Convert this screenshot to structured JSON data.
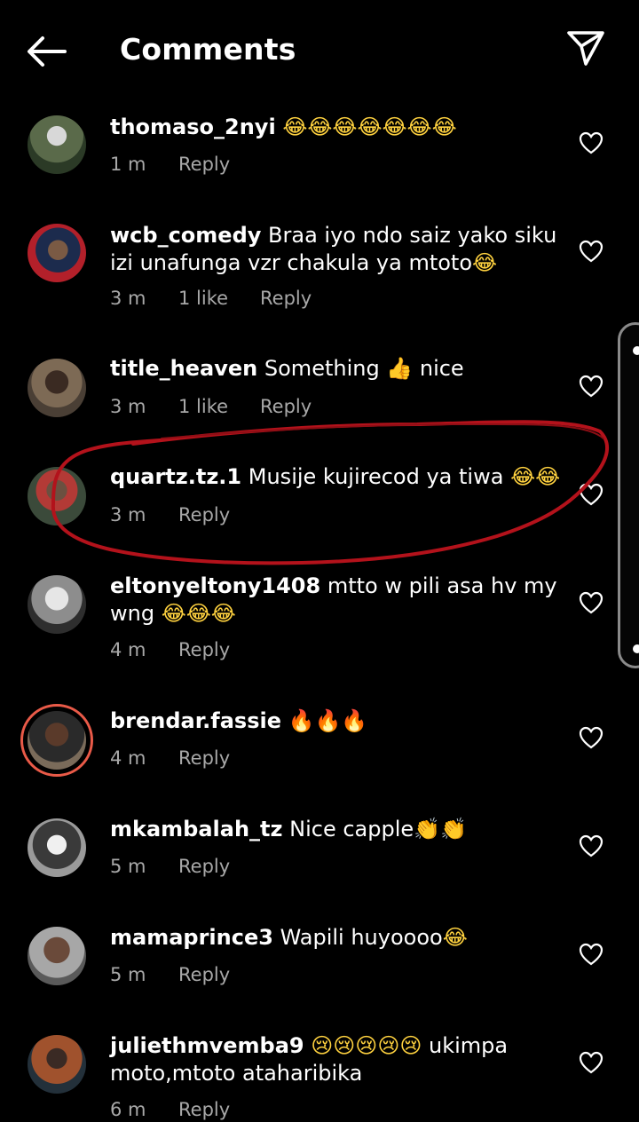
{
  "header": {
    "title": "Comments",
    "back_icon": "arrow-left-icon",
    "send_icon": "paper-plane-icon"
  },
  "colors": {
    "background": "#000000",
    "text": "#ffffff",
    "meta_text": "#a8a8a8",
    "annotation": "#b3121b",
    "story_ring": "#e95a48"
  },
  "comments": [
    {
      "username": "thomaso_2nyi",
      "text": "",
      "emoji": "😂😂😂😂😂😂😂",
      "time": "1 m",
      "likes": "",
      "reply": "Reply"
    },
    {
      "username": "wcb_comedy",
      "text": "Braa iyo ndo saiz yako siku izi unafunga vzr chakula ya mtoto",
      "emoji": "😂",
      "time": "3 m",
      "likes": "1 like",
      "reply": "Reply"
    },
    {
      "username": "title_heaven",
      "text": "Something",
      "emoji": "👍",
      "text_after": "nice",
      "time": "3 m",
      "likes": "1 like",
      "reply": "Reply"
    },
    {
      "username": "quartz.tz.1",
      "text": "Musije kujirecod ya tiwa",
      "emoji": "😂😂",
      "time": "3 m",
      "likes": "",
      "reply": "Reply"
    },
    {
      "username": "eltonyeltony1408",
      "text": "mtto w pili asa hv my wng",
      "emoji": "😂😂😂",
      "time": "4 m",
      "likes": "",
      "reply": "Reply"
    },
    {
      "username": "brendar.fassie",
      "text": "",
      "emoji": "🔥🔥🔥",
      "time": "4 m",
      "likes": "",
      "reply": "Reply"
    },
    {
      "username": "mkambalah_tz",
      "text": "Nice capple",
      "emoji": "👏👏",
      "time": "5 m",
      "likes": "",
      "reply": "Reply"
    },
    {
      "username": "mamaprince3",
      "text": "Wapili huyoooo",
      "emoji": "😂",
      "time": "5 m",
      "likes": "",
      "reply": "Reply"
    },
    {
      "username": "juliethmvemba9",
      "text": "",
      "emoji": "😢😢😢😢😢",
      "text_after": "ukimpa moto,mtoto ataharibika",
      "time": "6 m",
      "likes": "",
      "reply": "Reply"
    }
  ]
}
